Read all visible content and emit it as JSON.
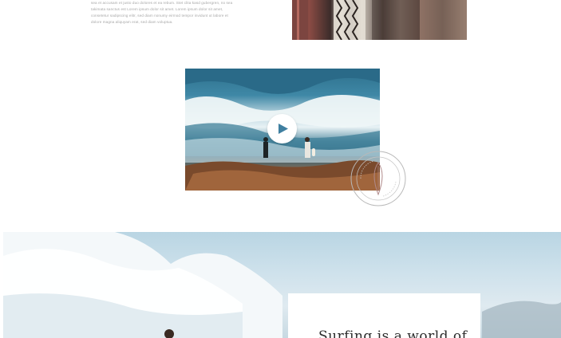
{
  "intro": {
    "lines": [
      "sea et accusam et justo duo dolores et ea rebum. Stet clita kasd gubergren, no sea",
      "takimata sanctus est Lorem ipsum dolor sit amet. Lorem ipsum dolor sit amet,",
      "consetetur sadipscing elitr, sed diam nonumy eirmod tempor invidunt ut labore et",
      "dolore magna aliquyam erat, sed diam voluptua."
    ]
  },
  "video": {
    "play_icon": "play-icon"
  },
  "stamp": {
    "icon": "surfboard-stamp-icon",
    "color": "#b0b0b0"
  },
  "hero": {
    "card_title": "Surfing is a world of"
  },
  "colors": {
    "background": "#ffffff",
    "text_muted": "#a7a7a7",
    "sea_dark": "#2d6f8c",
    "rock": "#8a5a3c"
  }
}
